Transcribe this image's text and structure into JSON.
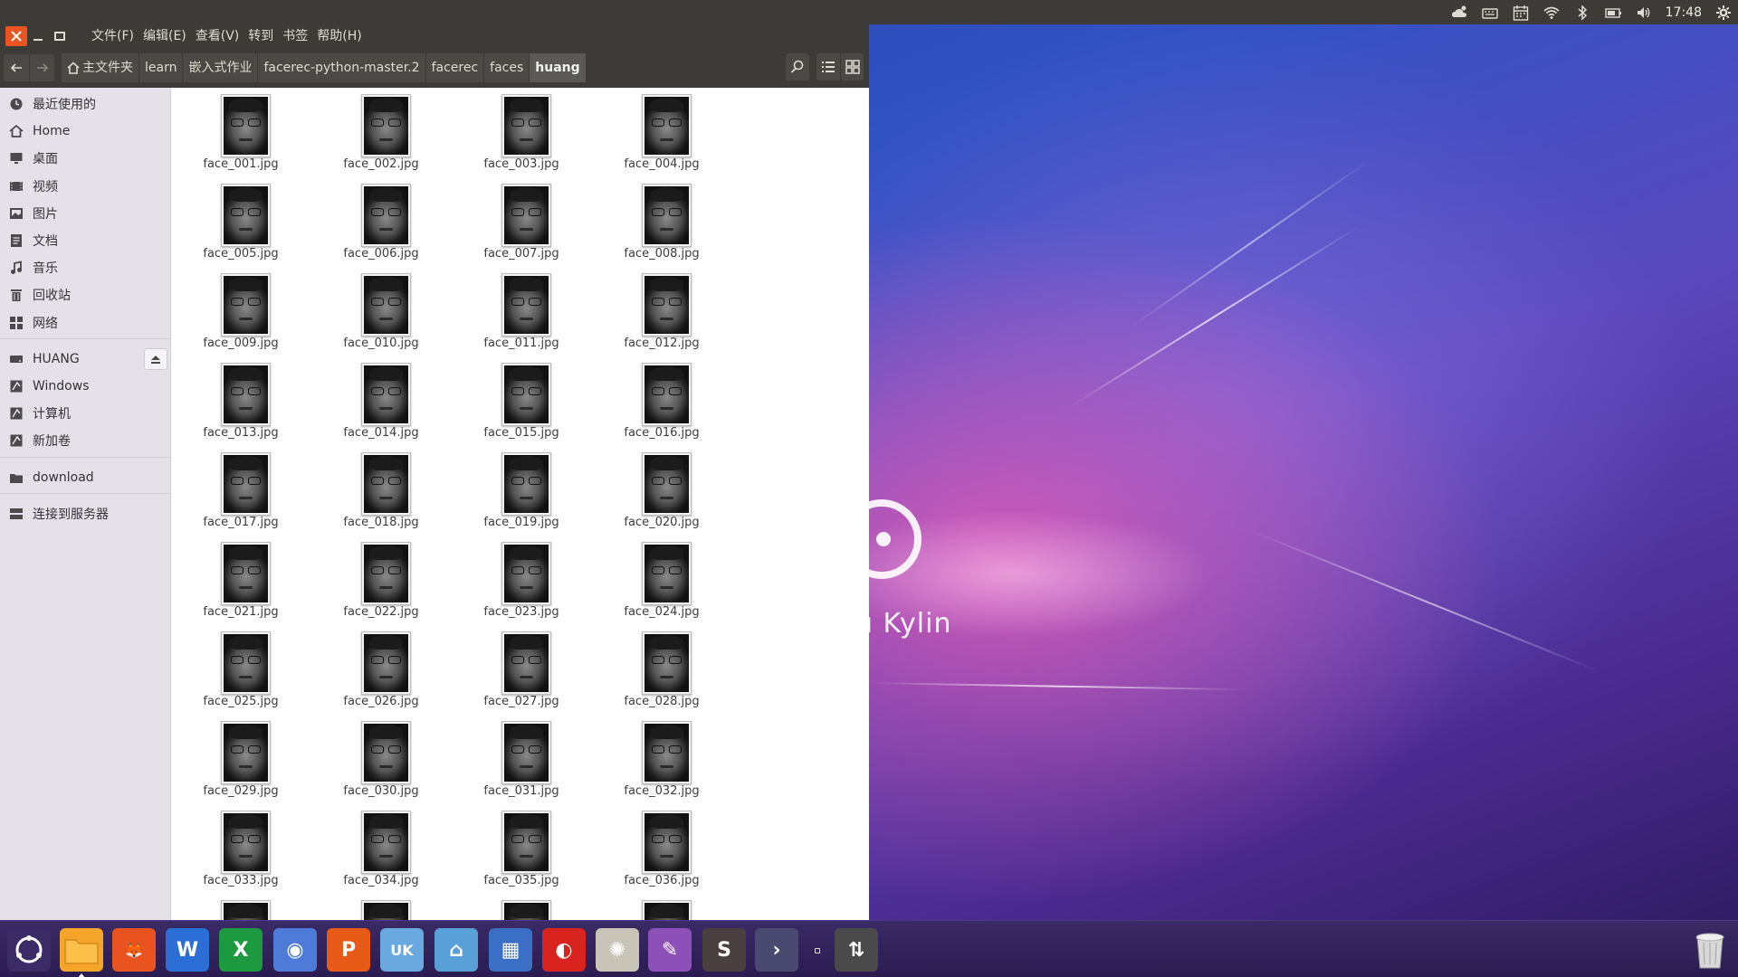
{
  "panel": {
    "clock": "17:48",
    "indicators": [
      "weather-icon",
      "keyboard-icon",
      "calendar-icon",
      "wifi-icon",
      "bluetooth-icon",
      "battery-icon",
      "volume-icon",
      "settings-gear-icon"
    ]
  },
  "window": {
    "menu": [
      "文件(F)",
      "编辑(E)",
      "查看(V)",
      "转到",
      "书签",
      "帮助(H)"
    ],
    "breadcrumb": [
      "主文件夹",
      "learn",
      "嵌入式作业",
      "facerec-python-master.2",
      "facerec",
      "faces",
      "huang"
    ]
  },
  "sidebar": {
    "places": [
      "最近使用的",
      "Home",
      "桌面",
      "视频",
      "图片",
      "文档",
      "音乐",
      "回收站",
      "网络"
    ],
    "devices": [
      "HUANG",
      "Windows",
      "计算机",
      "新加卷"
    ],
    "bookmarks": [
      "download"
    ],
    "network": [
      "连接到服务器"
    ]
  },
  "files": [
    "face_001.jpg",
    "face_002.jpg",
    "face_003.jpg",
    "face_004.jpg",
    "face_005.jpg",
    "face_006.jpg",
    "face_007.jpg",
    "face_008.jpg",
    "face_009.jpg",
    "face_010.jpg",
    "face_011.jpg",
    "face_012.jpg",
    "face_013.jpg",
    "face_014.jpg",
    "face_015.jpg",
    "face_016.jpg",
    "face_017.jpg",
    "face_018.jpg",
    "face_019.jpg",
    "face_020.jpg",
    "face_021.jpg",
    "face_022.jpg",
    "face_023.jpg",
    "face_024.jpg",
    "face_025.jpg",
    "face_026.jpg",
    "face_027.jpg",
    "face_028.jpg",
    "face_029.jpg",
    "face_030.jpg",
    "face_031.jpg",
    "face_032.jpg",
    "face_033.jpg",
    "face_034.jpg",
    "face_035.jpg",
    "face_036.jpg"
  ],
  "desktop": {
    "brand_text": "u Kylin"
  },
  "dock": {
    "items": [
      {
        "name": "kylin-start-icon",
        "color": "#3a2a66",
        "glyph": "◎"
      },
      {
        "name": "files-folder-icon",
        "color": "#f5a52a",
        "glyph": ""
      },
      {
        "name": "firefox-icon",
        "color": "#e8531f",
        "glyph": "🦊"
      },
      {
        "name": "wps-writer-icon",
        "color": "#2b6fd6",
        "glyph": "W"
      },
      {
        "name": "wps-spreadsheet-icon",
        "color": "#1d9a3f",
        "glyph": "X"
      },
      {
        "name": "chromium-icon",
        "color": "#4f7bd8",
        "glyph": "◉"
      },
      {
        "name": "wps-presentation-icon",
        "color": "#e85a18",
        "glyph": "P"
      },
      {
        "name": "ubuntu-kylin-software-center-icon",
        "color": "#6aa9e0",
        "glyph": "UK"
      },
      {
        "name": "scanner-icon",
        "color": "#5aa0d8",
        "glyph": "⌂"
      },
      {
        "name": "workspace-switcher-icon",
        "color": "#3b6fc6",
        "glyph": "▦"
      },
      {
        "name": "netease-music-icon",
        "color": "#d9231f",
        "glyph": "◐"
      },
      {
        "name": "compass-icon",
        "color": "#c9c4b8",
        "glyph": "✺"
      },
      {
        "name": "text-editor-icon",
        "color": "#8d4fb8",
        "glyph": "✎"
      },
      {
        "name": "sublime-text-icon",
        "color": "#4a4040",
        "glyph": "S"
      },
      {
        "name": "visual-studio-code-icon",
        "color": "#4a4a70",
        "glyph": "›"
      },
      {
        "name": "usb-drive-icon",
        "color": "#4a4a4a",
        "glyph": "⇅"
      }
    ]
  }
}
